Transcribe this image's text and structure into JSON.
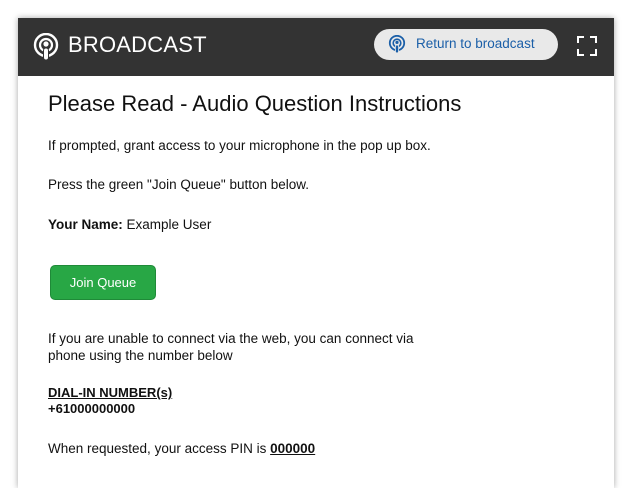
{
  "header": {
    "app_title": "BROADCAST",
    "return_label": "Return to broadcast",
    "background_color": "#333333",
    "return_button_color": "#e9e9e9"
  },
  "content": {
    "title": "Please Read - Audio Question Instructions",
    "prompt_text": "If prompted, grant access to your microphone in the pop up box.",
    "press_text": "Press the green \"Join Queue\" button below.",
    "your_name_label": "Your Name:",
    "your_name_value": "Example User",
    "join_button_label": "Join Queue",
    "join_button_color": "#28a745",
    "unable_line1": "If you are unable to connect via the web, you can connect via",
    "unable_line2": "phone using the number below",
    "dial_in_heading": "DIAL-IN NUMBER(s)",
    "dial_in_number": "+61000000000",
    "pin_prefix": "When requested, your access PIN is",
    "pin_value": "000000"
  },
  "icons": {
    "logo": "podcast-icon",
    "return": "podcast-icon",
    "fullscreen": "fullscreen-icon"
  }
}
